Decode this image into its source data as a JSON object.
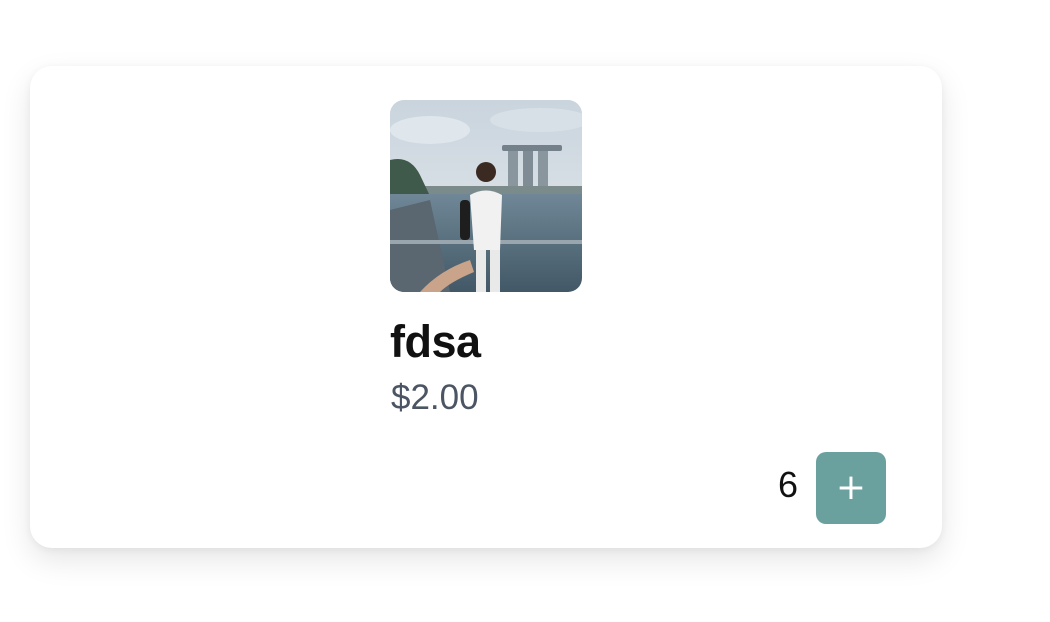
{
  "product": {
    "name": "fdsa",
    "price": "$2.00",
    "image_icon": "product-photo"
  },
  "cart": {
    "quantity": "6",
    "add_label": "+"
  },
  "colors": {
    "accent": "#6aa09e",
    "price_text": "#4b5563"
  }
}
